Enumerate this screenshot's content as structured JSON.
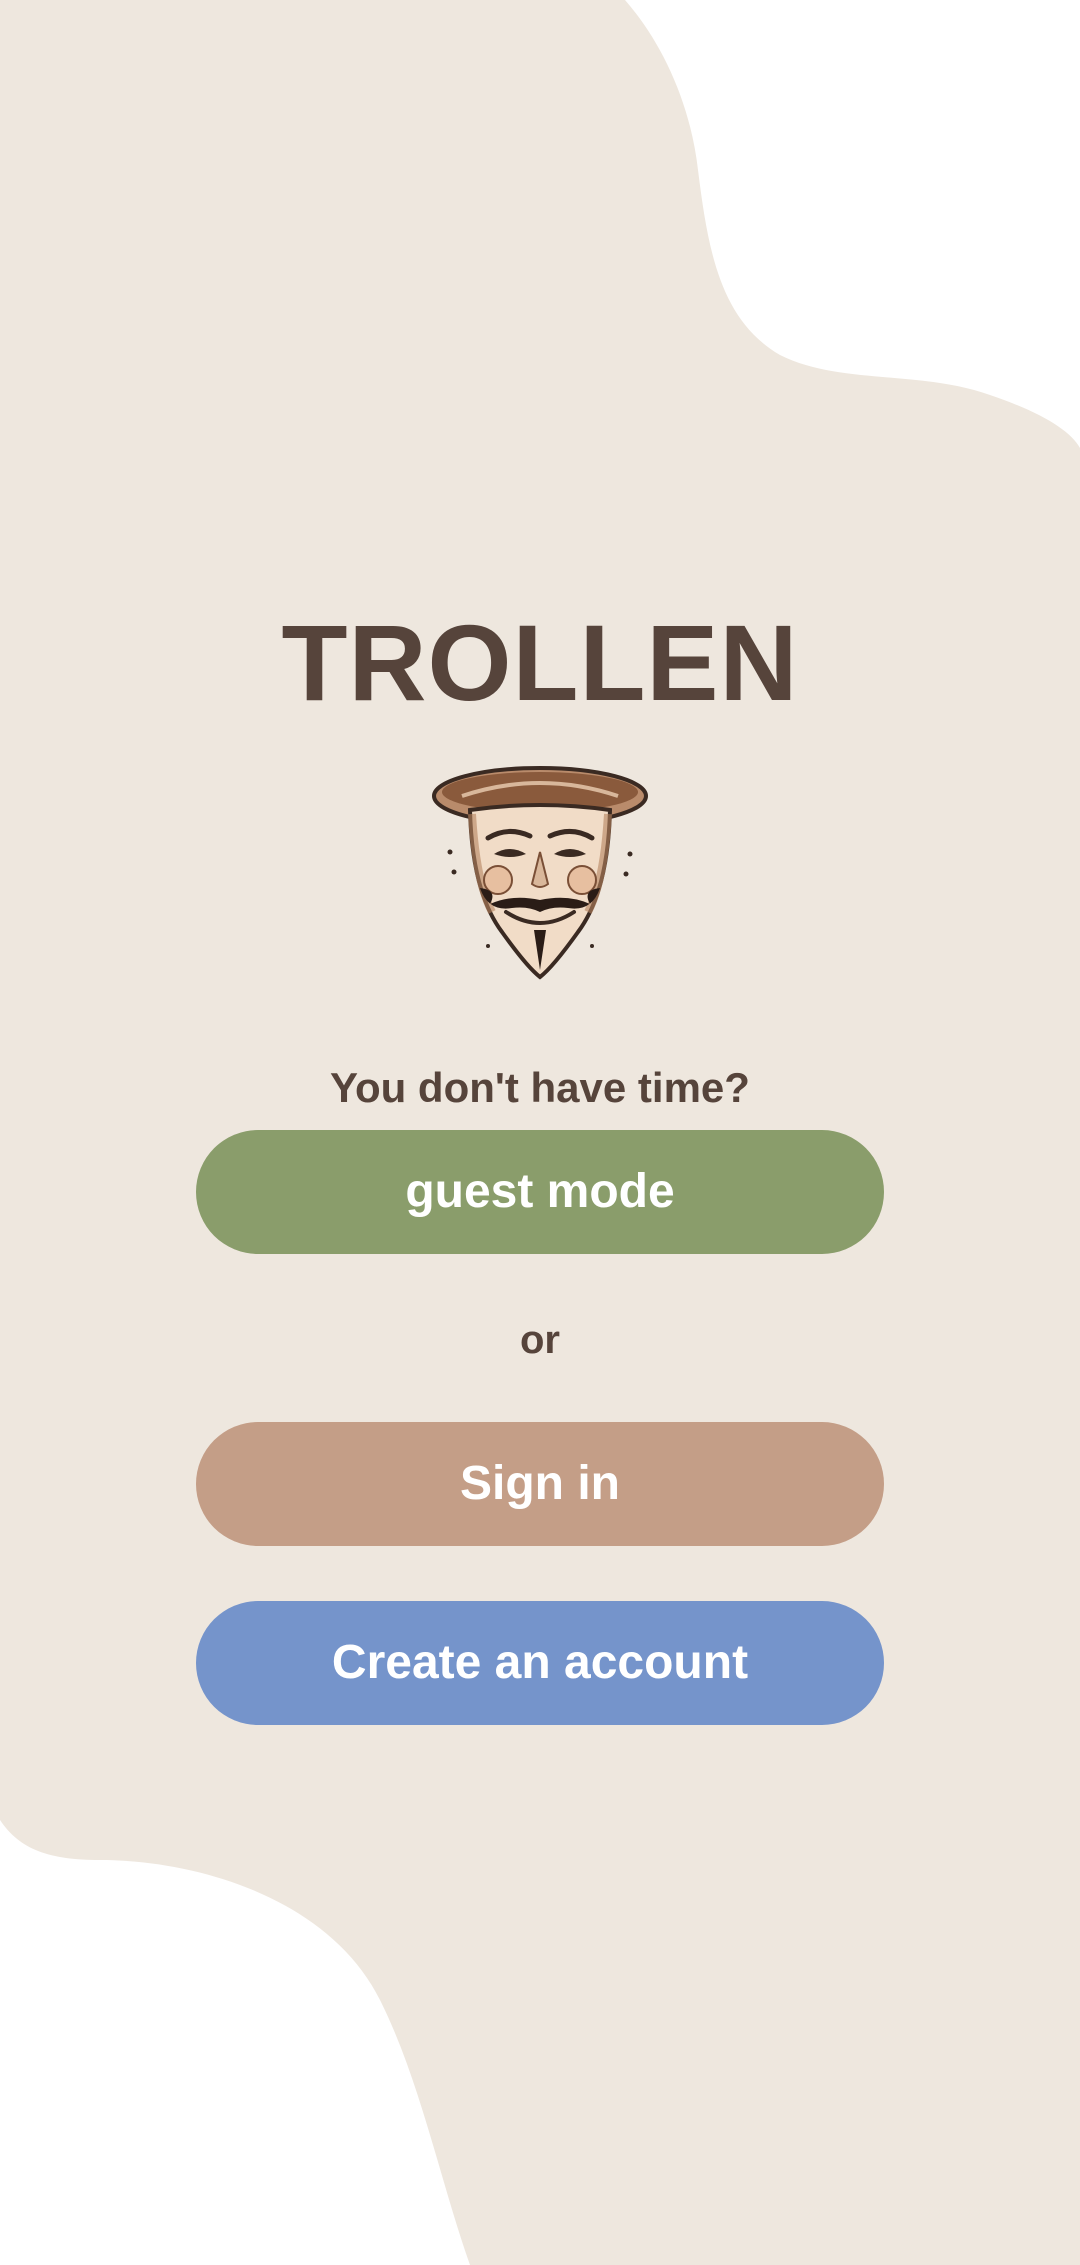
{
  "app": {
    "title": "TROLLEN"
  },
  "logo": {
    "icon": "guy-fawkes-mask-icon"
  },
  "prompt": {
    "text": "You don't have time?"
  },
  "buttons": {
    "guest": "guest mode",
    "separator": "or",
    "signin": "Sign in",
    "create": "Create an account"
  },
  "colors": {
    "background_shape": "#eee7de",
    "text": "#56443b",
    "guest_button": "#8a9d6b",
    "signin_button": "#c49e87",
    "create_button": "#7594cb"
  }
}
